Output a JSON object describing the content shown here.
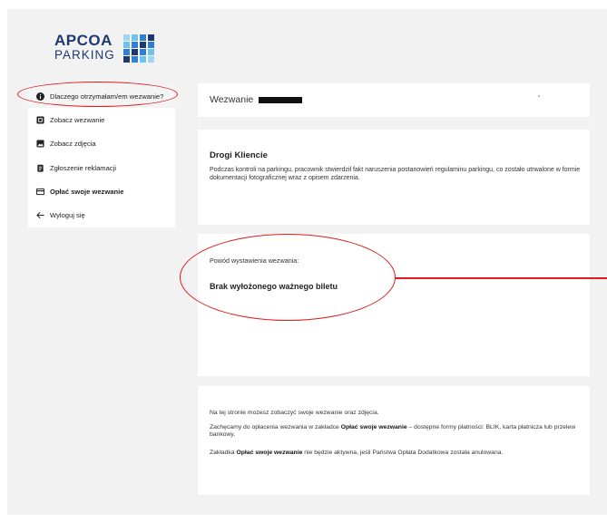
{
  "logo": {
    "line1": "APCOA",
    "line2": "PARKING",
    "colors": [
      "#1d3a6e",
      "#2f7fd8",
      "#6cc3ef"
    ]
  },
  "sidebar": {
    "items": [
      {
        "label": "Dlaczego otrzymałam/em wezwanie?",
        "icon": "info-icon"
      },
      {
        "label": "Zobacz wezwanie",
        "icon": "document-icon"
      },
      {
        "label": "Zobacz zdjęcia",
        "icon": "image-icon"
      },
      {
        "label": "Zgłoszenie reklamacji",
        "icon": "clipboard-icon"
      },
      {
        "label": "Opłać swoje wezwanie",
        "icon": "credit-card-icon"
      },
      {
        "label": "Wyloguj się",
        "icon": "arrow-left-icon"
      }
    ]
  },
  "header": {
    "title": "Wezwanie"
  },
  "intro": {
    "greeting": "Drogi Kliencie",
    "text": "Podczas kontroli na parkingu, pracownik stwierdził fakt naruszenia postanowień regulaminu parkingu, co zostało utrwalone w formie dokumentacji fotograficznej wraz z opisem zdarzenia."
  },
  "reason": {
    "label": "Powód wystawienia wezwania:",
    "value": "Brak wyłożonego ważnego biletu"
  },
  "info": {
    "line1": "Na tej stronie możesz zobaczyć swoje wezwanie oraz zdjęcia.",
    "line2_pre": "Zachęcamy do opłacenia wezwania w zakładce ",
    "line2_bold": "Opłać swoje wezwanie",
    "line2_post": " – dostępne formy płatności: BLIK, karta płatnicza lub przelew bankowy.",
    "line3_pre": "Zakładka ",
    "line3_bold": "Opłać swoje wezwanie",
    "line3_post": " nie będzie aktywna, jeśli Państwa Opłata Dodatkowa została anulowana."
  },
  "colors": {
    "annotation": "#e01b1b",
    "brand": "#1d3a6e",
    "background": "#f2f2f2"
  }
}
